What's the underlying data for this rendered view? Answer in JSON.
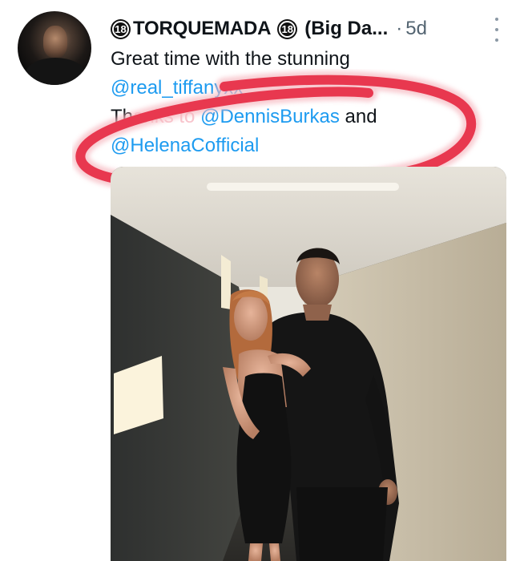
{
  "tweet": {
    "badge_left": "18",
    "display_name": "TORQUEMADA",
    "badge_right": "18",
    "name_tail": "(Big Da...",
    "time_separator": "·",
    "timestamp": "5d",
    "text": {
      "line1": "Great time with the stunning",
      "mention1": "@real_tiffanyxx",
      "line3_prefix": "Th",
      "line3_obscured": "anks to",
      "mention2": "@DennisBurkas",
      "line3_suffix": "and",
      "mention3": "@HelenaCofficial"
    }
  },
  "colors": {
    "mention": "#1d9bf0",
    "text": "#0f1419",
    "secondary": "#536471",
    "marker": "#e8384f"
  },
  "icons": {
    "more": "ellipsis-vertical-icon",
    "badge": "18-plus-badge-icon"
  }
}
